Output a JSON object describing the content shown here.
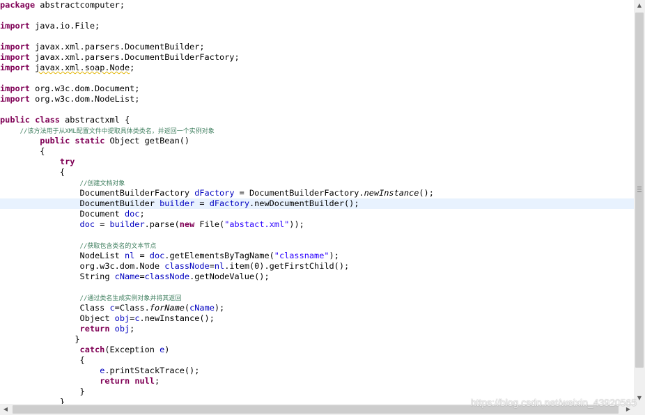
{
  "editor": {
    "lines": [
      "package abstractcomputer;",
      "",
      "import java.io.File;",
      "",
      "import javax.xml.parsers.DocumentBuilder;",
      "import javax.xml.parsers.DocumentBuilderFactory;",
      "import javax.xml.soap.Node;",
      "",
      "import org.w3c.dom.Document;",
      "import org.w3c.dom.NodeList;",
      "",
      "public class abstractxml {",
      "    //该方法用于从XML配置文件中提取具体类类名，并返回一个实例对象",
      "        public static Object getBean()",
      "        {",
      "            try",
      "            {",
      "                //创建文档对象",
      "                DocumentBuilderFactory dFactory = DocumentBuilderFactory.newInstance();",
      "                DocumentBuilder builder = dFactory.newDocumentBuilder();",
      "                Document doc;",
      "                doc = builder.parse(new File(\"abstact.xml\"));",
      "",
      "                //获取包含类名的文本节点",
      "                NodeList nl = doc.getElementsByTagName(\"classname\");",
      "                org.w3c.dom.Node classNode=nl.item(0).getFirstChild();",
      "                String cName=classNode.getNodeValue();",
      "",
      "                //通过类名生成实例对象并将其返回",
      "                Class c=Class.forName(cName);",
      "                Object obj=c.newInstance();",
      "                return obj;",
      "               }",
      "                catch(Exception e)",
      "                {",
      "                    e.printStackTrace();",
      "                    return null;",
      "                }",
      "            }"
    ]
  },
  "watermark": "https://blog.csdn.net/weixin_43920565",
  "colors": {
    "keyword": "#7f0055",
    "string": "#2a00ff",
    "comment": "#3f7f5f",
    "field": "#0000c0",
    "current_line": "#e8f2fe"
  },
  "icons": {
    "scroll_up": "arrow-up-icon",
    "scroll_down": "arrow-down-icon",
    "scroll_left": "arrow-left-icon",
    "scroll_right": "arrow-right-icon"
  }
}
